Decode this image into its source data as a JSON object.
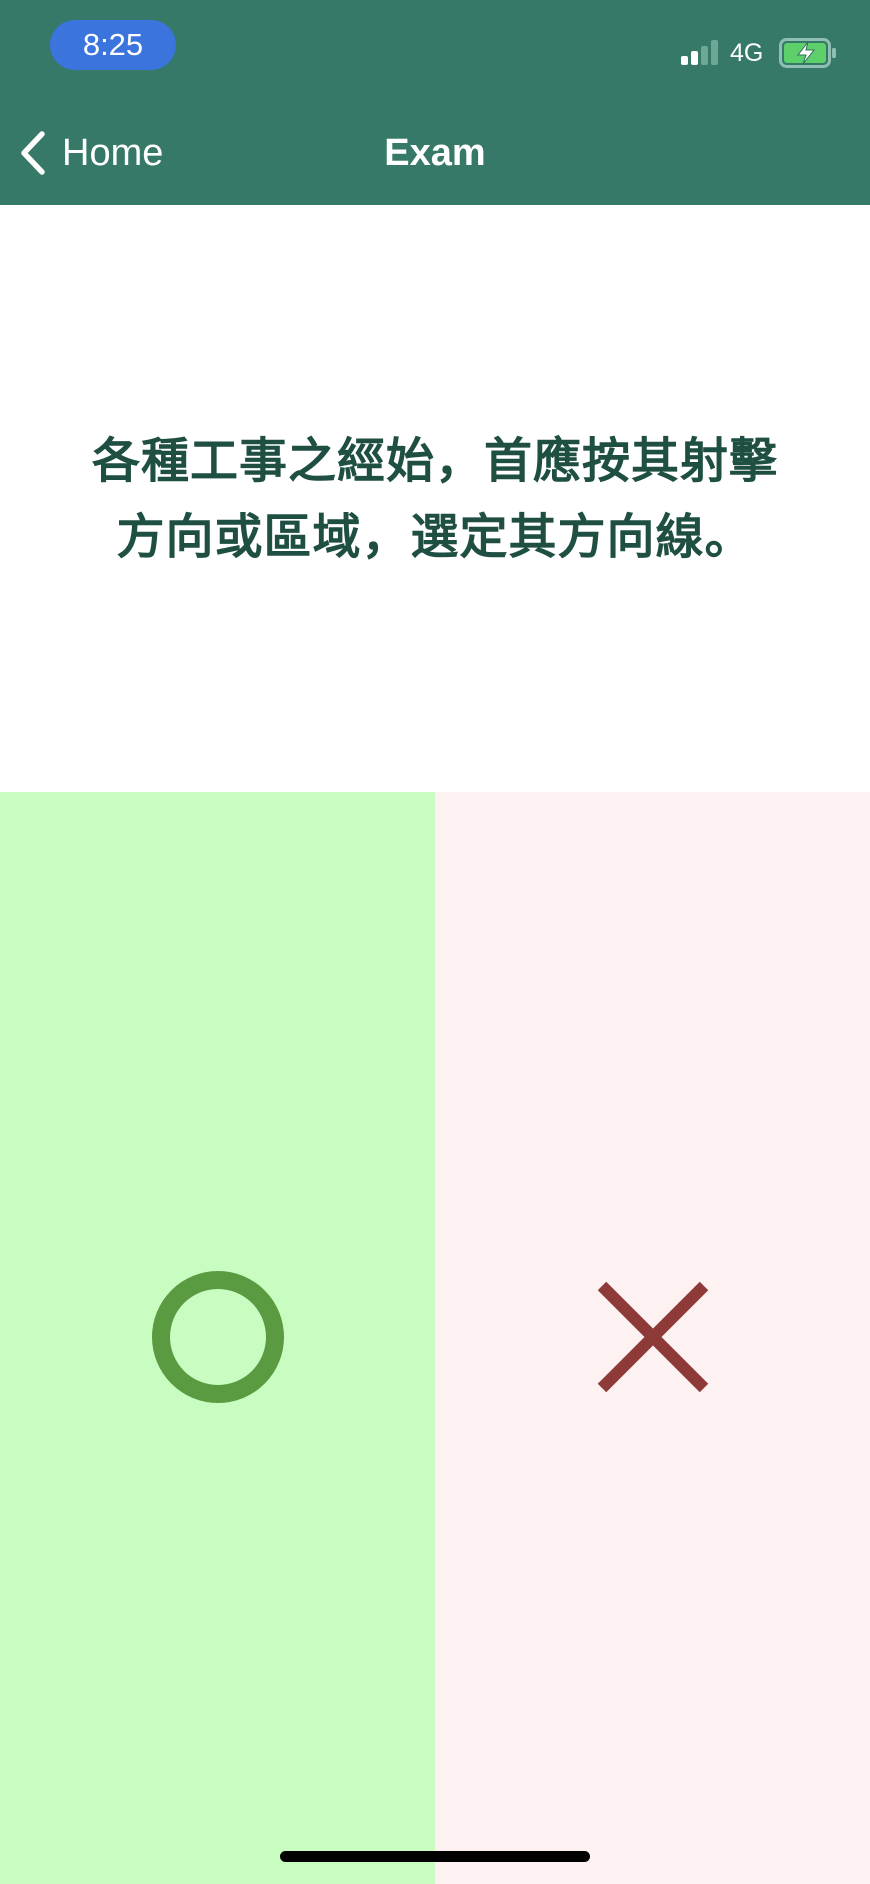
{
  "status_bar": {
    "time": "8:25",
    "network": "4G",
    "signal_bars_active": 2,
    "signal_bars_total": 4,
    "battery_state": "charging",
    "battery_icon": "battery-charging-icon",
    "signal_icon": "cellular-signal-icon"
  },
  "nav": {
    "back_label": "Home",
    "back_icon": "chevron-left-icon",
    "title": "Exam"
  },
  "question": {
    "text": "各種工事之經始，首應按其射擊方向或區域，選定其方向線。"
  },
  "answers": {
    "true_icon": "circle-o-icon",
    "false_icon": "cross-x-icon"
  },
  "colors": {
    "header_bg": "#367968",
    "time_pill_bg": "#3a74dc",
    "question_text": "#1f4f43",
    "true_panel_bg": "#c8fcc1",
    "false_panel_bg": "#fdf1f1",
    "true_icon": "#5a9a40",
    "false_icon": "#8d3a39",
    "signal_active": "#ffffff",
    "signal_inactive": "#6da896",
    "battery_fill": "#5ed06b",
    "battery_outline": "#8fbfb1"
  }
}
